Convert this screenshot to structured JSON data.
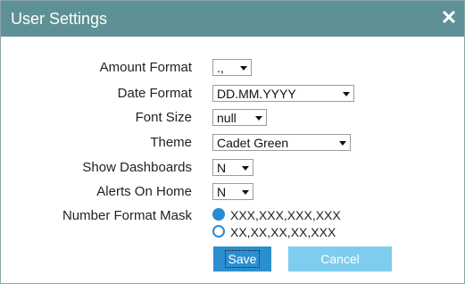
{
  "dialog": {
    "title": "User Settings",
    "close_glyph": "✕",
    "colors": {
      "titlebar": "#5d9196",
      "save_button": "#2b8fcf",
      "cancel_button": "#7ecdee",
      "radio": "#2a8ad0"
    }
  },
  "form": {
    "amount_format": {
      "label": "Amount Format",
      "value": ".,"
    },
    "date_format": {
      "label": "Date Format",
      "value": "DD.MM.YYYY"
    },
    "font_size": {
      "label": "Font Size",
      "value": "null"
    },
    "theme": {
      "label": "Theme",
      "value": "Cadet Green"
    },
    "show_dashboards": {
      "label": "Show Dashboards",
      "value": "N"
    },
    "alerts_on_home": {
      "label": "Alerts On Home",
      "value": "N"
    },
    "number_format_mask": {
      "label": "Number Format Mask",
      "options": [
        {
          "text": "XXX,XXX,XXX,XXX",
          "checked": true
        },
        {
          "text": "XX,XX,XX,XX,XXX",
          "checked": false
        }
      ]
    }
  },
  "buttons": {
    "save": "Save",
    "cancel": "Cancel"
  }
}
